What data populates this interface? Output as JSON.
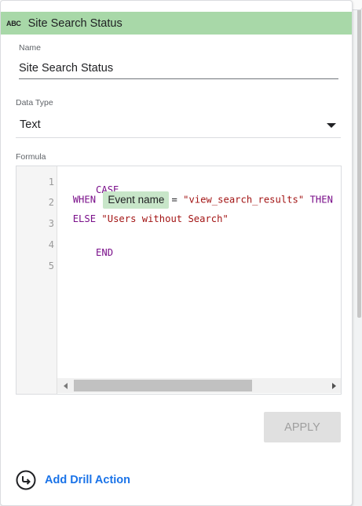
{
  "panel": {
    "header_title": "Site Search Status",
    "type_icon": "abc-icon",
    "type_icon_text": "ABC",
    "header_color": "#a8d8a8"
  },
  "name_field": {
    "label": "Name",
    "value": "Site Search Status"
  },
  "data_type": {
    "label": "Data Type",
    "selected": "Text"
  },
  "formula": {
    "label": "Formula",
    "line_numbers": [
      "1",
      "2",
      "3",
      "4",
      "5"
    ],
    "lines": {
      "l1_keyword": "CASE",
      "l2_when": "WHEN",
      "l2_field_chip": "Event name",
      "l2_operator": "=",
      "l2_string": "\"view_search_results\"",
      "l2_then": "THEN",
      "l3_else": "ELSE",
      "l3_string": "\"Users without Search\"",
      "l4_keyword": "END"
    },
    "colors": {
      "keyword": "#7a0f8a",
      "string": "#a31515",
      "field_chip": "#c8e6c9"
    }
  },
  "actions": {
    "apply_label": "APPLY",
    "add_drill_label": "Add Drill Action",
    "accent_color": "#1a73e8"
  }
}
